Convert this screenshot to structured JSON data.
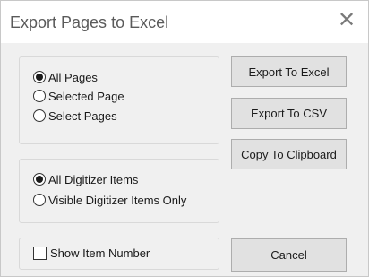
{
  "window": {
    "title": "Export Pages to Excel",
    "close_glyph": "✕"
  },
  "page_scope": {
    "options": [
      {
        "label": "All Pages",
        "checked": true
      },
      {
        "label": "Selected Page",
        "checked": false
      },
      {
        "label": "Select Pages",
        "checked": false
      }
    ]
  },
  "item_scope": {
    "options": [
      {
        "label": "All Digitizer Items",
        "checked": true
      },
      {
        "label": "Visible Digitizer Items Only",
        "checked": false
      }
    ]
  },
  "show_item_number": {
    "label": "Show Item Number",
    "checked": false
  },
  "buttons": {
    "export_excel": "Export To Excel",
    "export_csv": "Export To CSV",
    "copy_clipboard": "Copy To Clipboard",
    "cancel": "Cancel"
  },
  "icons": {
    "close": "close-icon"
  }
}
